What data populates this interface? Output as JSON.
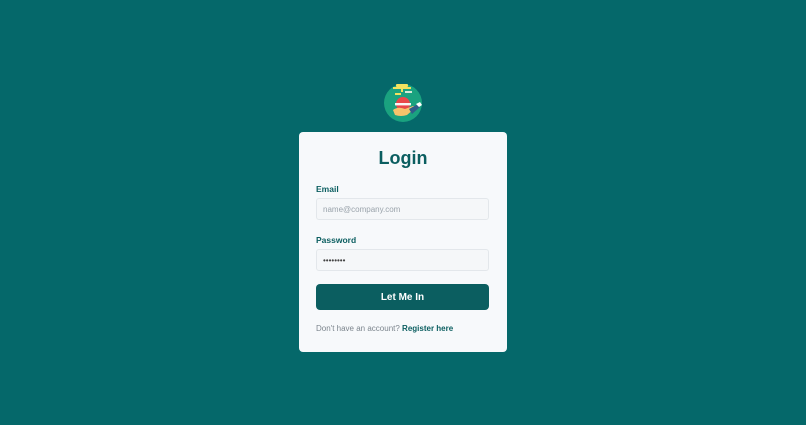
{
  "login": {
    "title": "Login",
    "email_label": "Email",
    "email_placeholder": "name@company.com",
    "email_value": "",
    "password_label": "Password",
    "password_value": "password",
    "submit_label": "Let Me In",
    "register_prompt": "Don't have an account?",
    "register_link": "Register here"
  },
  "logo": {
    "icon": "mortar-board-hand-icon"
  },
  "colors": {
    "background": "#05686a",
    "accent": "#0b5e60",
    "card": "#f7f9fb"
  }
}
